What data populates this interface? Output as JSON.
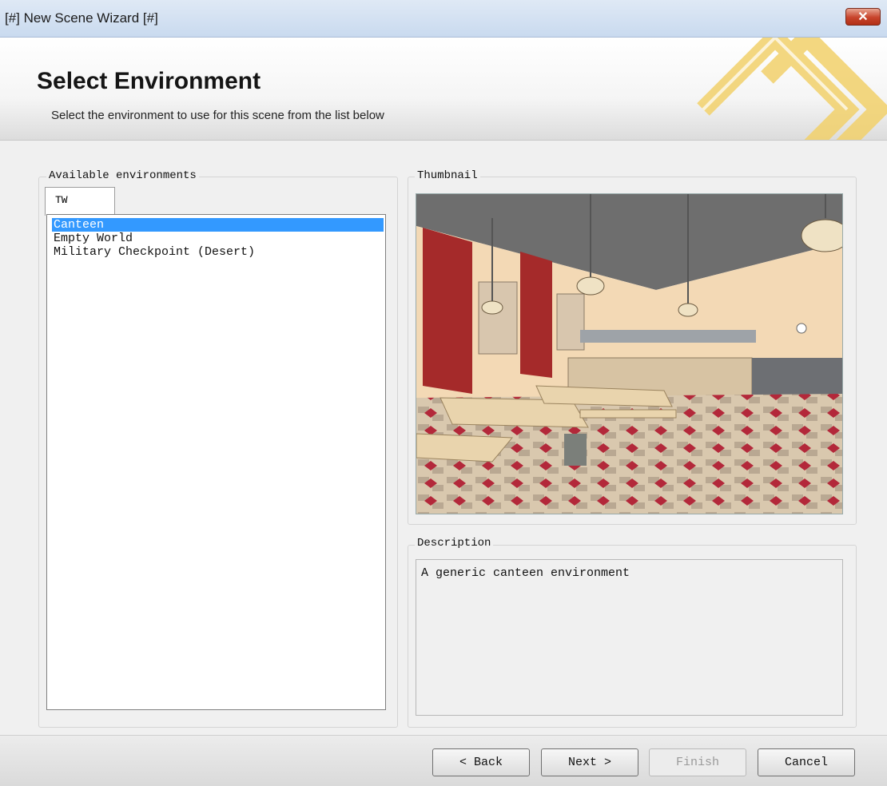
{
  "window": {
    "title": "[#] New Scene Wizard [#]",
    "close_label": "✕"
  },
  "header": {
    "title": "Select Environment",
    "subtitle": "Select the environment to use for this scene from the list below"
  },
  "environments": {
    "label": "Available environments",
    "tab": "TW",
    "items": [
      "Canteen",
      "Empty World",
      "Military Checkpoint (Desert)"
    ],
    "selected_index": 0
  },
  "thumbnail": {
    "label": "Thumbnail"
  },
  "description": {
    "label": "Description",
    "text": "A generic canteen environment"
  },
  "buttons": {
    "back": "< Back",
    "next": "Next >",
    "finish": "Finish",
    "cancel": "Cancel"
  },
  "colors": {
    "selection": "#3399ff",
    "logo": "#f2d16b",
    "wall": "#a52a2a"
  }
}
